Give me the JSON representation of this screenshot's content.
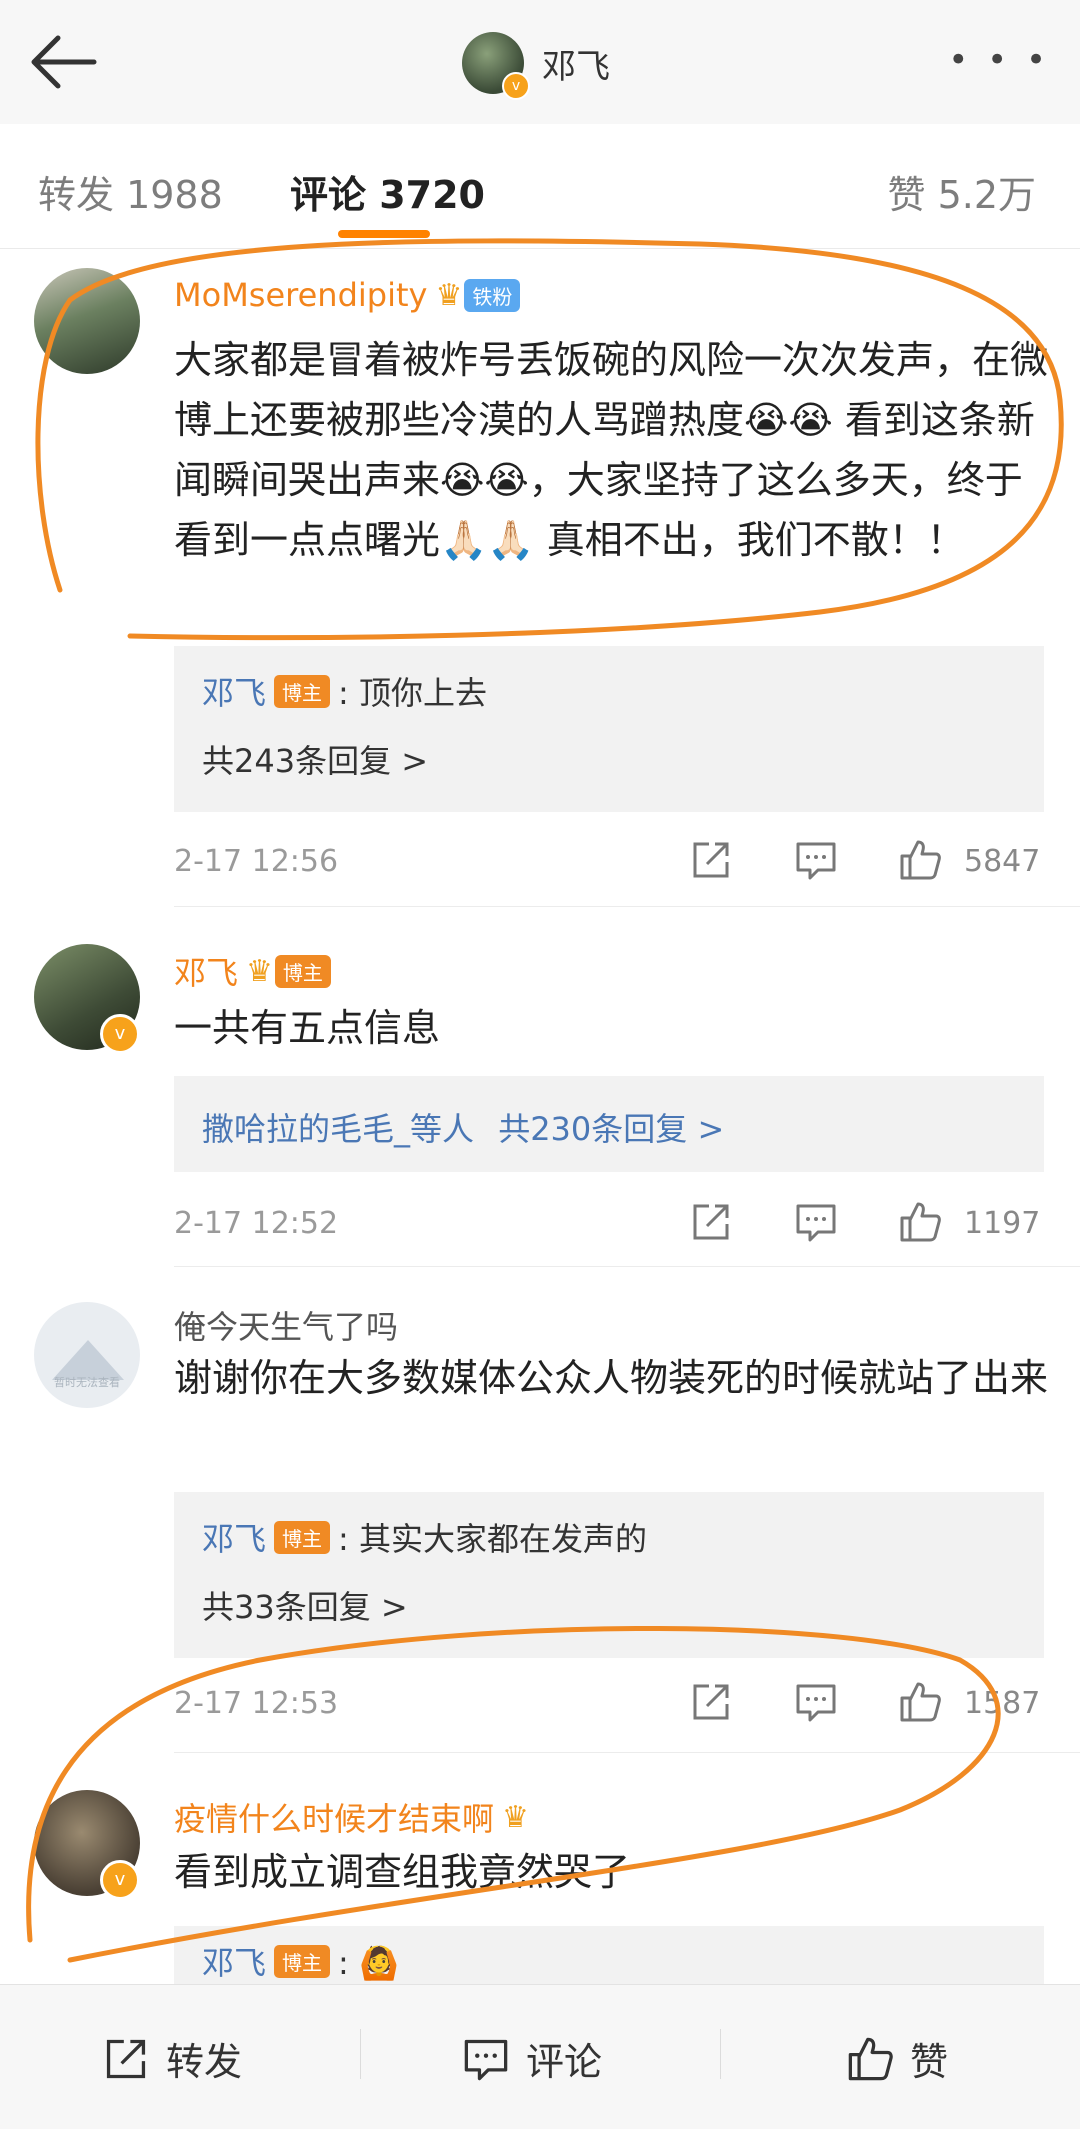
{
  "header": {
    "title": "邓飞",
    "more": "• • •"
  },
  "tabs": {
    "repost": "转发 1988",
    "comment": "评论 3720",
    "like": "赞 5.2万"
  },
  "comments": [
    {
      "name": "MoMserendipity",
      "badge": "铁粉",
      "text": "大家都是冒着被炸号丢饭碗的风险一次次发声，在微博上还要被那些冷漠的人骂蹭热度😭😭 看到这条新闻瞬间哭出声来😭😭，大家坚持了这么多天，终于看到一点点曙光🙏🏻🙏🏻 真相不出，我们不散！！",
      "reply_name": "邓飞",
      "reply_badge": "博主",
      "reply_text": ": 顶你上去",
      "reply_more": "共243条回复 >",
      "time": "2-17 12:56",
      "likes": "5847"
    },
    {
      "name": "邓飞",
      "badge": "博主",
      "text": "一共有五点信息",
      "reply_line": "撒哈拉的毛毛_等人",
      "reply_more": "共230条回复 >",
      "time": "2-17 12:52",
      "likes": "1197"
    },
    {
      "name": "俺今天生气了吗",
      "avatar_caption": "暂时无法查看",
      "text": "谢谢你在大多数媒体公众人物装死的时候就站了出来",
      "reply_name": "邓飞",
      "reply_badge": "博主",
      "reply_text": ": 其实大家都在发声的",
      "reply_more": "共33条回复 >",
      "time": "2-17 12:53",
      "likes": "1587"
    },
    {
      "name": "疫情什么时候才结束啊",
      "text": "看到成立调查组我竟然哭了",
      "reply_name": "邓飞",
      "reply_badge": "博主",
      "reply_text": ": 🙆"
    }
  ],
  "bottom": {
    "repost": "转发",
    "comment": "评论",
    "like": "赞"
  },
  "colors": {
    "accent": "#ff8200",
    "annotation": "#f08a24",
    "link": "#4a77b5"
  }
}
